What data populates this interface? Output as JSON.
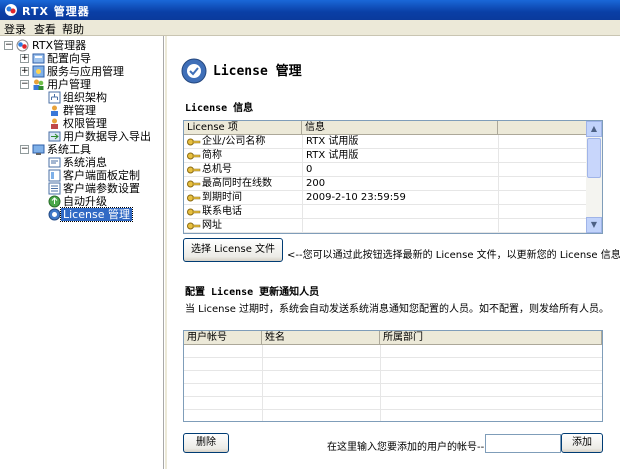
{
  "window": {
    "title": "RTX 管理器"
  },
  "menu": [
    "登录",
    "查看",
    "帮助"
  ],
  "tree": {
    "root": "RTX管理器",
    "nodes": [
      "配置向导",
      "服务与应用管理",
      "用户管理",
      "组织架构",
      "群管理",
      "权限管理",
      "用户数据导入导出",
      "系统工具",
      "系统消息",
      "客户端面板定制",
      "客户端参数设置",
      "自动升级",
      "License 管理"
    ]
  },
  "page": {
    "title": "License 管理",
    "license_section": "License 信息",
    "license_columns": [
      "License 项",
      "信息"
    ],
    "license_rows": [
      {
        "item": "企业/公司名称",
        "value": "RTX 试用版"
      },
      {
        "item": "简称",
        "value": "RTX 试用版"
      },
      {
        "item": "总机号",
        "value": "0"
      },
      {
        "item": "最高同时在线数",
        "value": "200"
      },
      {
        "item": "到期时间",
        "value": "2009-2-10 23:59:59"
      },
      {
        "item": "联系电话",
        "value": ""
      },
      {
        "item": "网址",
        "value": ""
      }
    ],
    "select_button": "选择 License 文件",
    "select_hint": "<--您可以通过此按钮选择最新的 License 文件，以更新您的 License 信息",
    "notify_section": "配置 License 更新通知人员",
    "notify_desc": "当 License 过期时，系统会自动发送系统消息通知您配置的人员。如不配置，则发给所有人员。",
    "user_columns": [
      "用户帐号",
      "姓名",
      "所属部门"
    ],
    "delete_button": "删除",
    "add_hint": "在这里输入您要添加的用户的帐号-->",
    "add_input_value": "",
    "add_button": "添加"
  }
}
